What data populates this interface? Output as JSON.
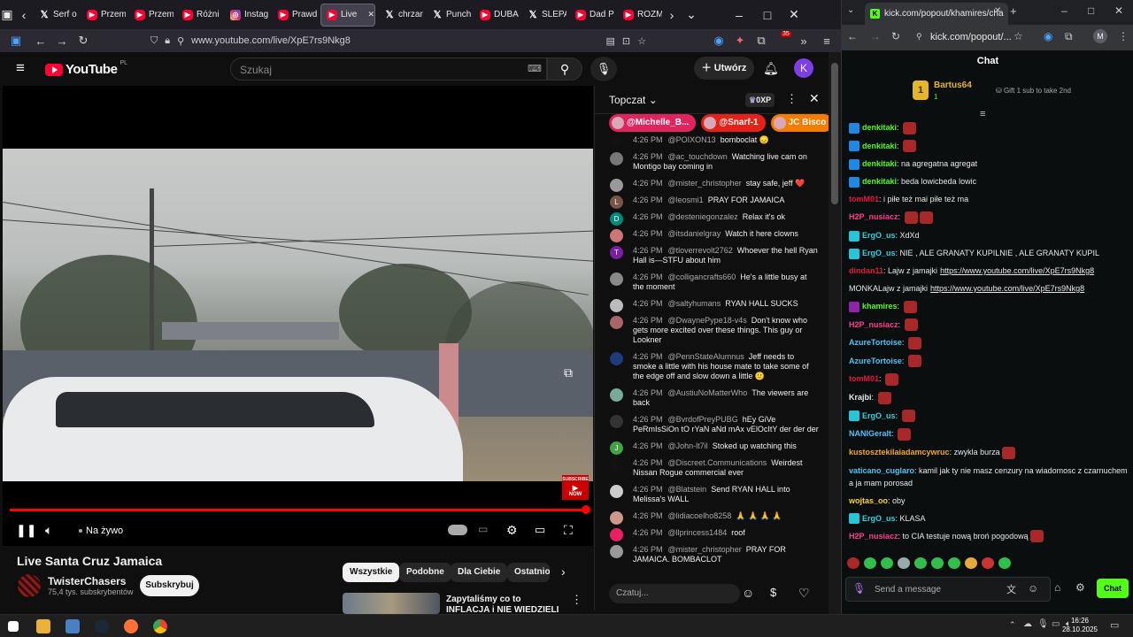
{
  "left_browser": {
    "tabs": [
      {
        "label": "Serf o",
        "icon": "x-icon"
      },
      {
        "label": "Przem",
        "icon": "youtube-icon"
      },
      {
        "label": "Przem",
        "icon": "youtube-icon"
      },
      {
        "label": "Różni",
        "icon": "youtube-icon"
      },
      {
        "label": "Instag",
        "icon": "instagram-icon"
      },
      {
        "label": "Prawd",
        "icon": "youtube-icon"
      },
      {
        "label": "Live",
        "icon": "youtube-icon"
      },
      {
        "label": "chrzan",
        "icon": "x-icon"
      },
      {
        "label": "Punch",
        "icon": "x-icon"
      },
      {
        "label": "DUBA",
        "icon": "youtube-icon"
      },
      {
        "label": "ŚLEPA",
        "icon": "x-icon"
      },
      {
        "label": "Dad P",
        "icon": "youtube-icon"
      },
      {
        "label": "ROZM",
        "icon": "youtube-icon"
      }
    ],
    "url": "www.youtube.com/live/XpE7rs9Nkg8",
    "ext_badge": "35"
  },
  "youtube": {
    "logo_text": "YouTube",
    "logo_region": "PL",
    "search_placeholder": "Szukaj",
    "create_label": "Utwórz",
    "avatar_letter": "K",
    "video": {
      "live_label": "Na żywo",
      "subscribe_badge_line1": "SUBSCRIBE",
      "subscribe_badge_line2": "NOW",
      "progress": 1.0
    },
    "title": "Live Santa Cruz Jamaica",
    "channel": "TwisterChasers",
    "subscribers": "75,4 tys. subskrybentów",
    "subscribe_label": "Subskrybuj",
    "chips": [
      "Wszystkie",
      "Podobne",
      "Dla Ciebie",
      "Ostatnio"
    ],
    "rec_title": "Zapytaliśmy co to INFLACJA i NIE WIEDZIELI"
  },
  "live_chat": {
    "header": "Topczat",
    "xp_badge": "0XP",
    "pinned": [
      {
        "name": "@Michelle_B...",
        "color": "#e0245e"
      },
      {
        "name": "@Snarf-1",
        "color": "#e62117"
      },
      {
        "name": "JC Bisco",
        "color": "#f57c00"
      }
    ],
    "messages": [
      {
        "time": "4:26 PM",
        "author": "@POIXON13",
        "text": "bomboclat 😞",
        "avatar": "",
        "color": "#111"
      },
      {
        "time": "4:26 PM",
        "author": "@ac_touchdown",
        "text": "Watching live cam on Montigo bay coming in",
        "avatar": "",
        "color": "#777"
      },
      {
        "time": "4:26 PM",
        "author": "@mister_christopher",
        "text": "stay safe, jeff ❤️",
        "avatar": "",
        "color": "#999"
      },
      {
        "time": "4:26 PM",
        "author": "@leosmi1",
        "text": "PRAY FOR JAMAICA",
        "avatar": "L",
        "color": "#795548"
      },
      {
        "time": "4:26 PM",
        "author": "@desteniegonzalez",
        "text": "Relax it's ok",
        "avatar": "D",
        "color": "#00897b"
      },
      {
        "time": "4:26 PM",
        "author": "@itsdanielgray",
        "text": "Watch it here clowns",
        "avatar": "",
        "color": "#c77"
      },
      {
        "time": "4:26 PM",
        "author": "@tloverrevolt2762",
        "text": "Whoever the hell Ryan Hall is—STFU about him",
        "avatar": "T",
        "color": "#7b1fa2"
      },
      {
        "time": "4:26 PM",
        "author": "@colligancrafts660",
        "text": "He's a little busy at the moment",
        "avatar": "",
        "color": "#888"
      },
      {
        "time": "4:26 PM",
        "author": "@saltyhumans",
        "text": "RYAN HALL SUCKS",
        "avatar": "",
        "color": "#bbb"
      },
      {
        "time": "4:26 PM",
        "author": "@DwaynePype18-v4s",
        "text": "Don't know who gets more excited over these things. This guy or Lookner",
        "avatar": "",
        "color": "#a66"
      },
      {
        "time": "4:26 PM",
        "author": "@PennStateAlumnus",
        "text": "Jeff needs to smoke a little with his house mate to take some of the edge off and slow down a little 🙂",
        "avatar": "",
        "color": "#1e3a7a"
      },
      {
        "time": "4:26 PM",
        "author": "@AustiuNoMatterWho",
        "text": "The viewers are back",
        "avatar": "",
        "color": "#7a9"
      },
      {
        "time": "4:26 PM",
        "author": "@BvrdofPreyPUBG",
        "text": "hEy GiVe PeRmIsSiOn tO rYaN aNd mAx vElOcItY der der der",
        "avatar": "",
        "color": "#333"
      },
      {
        "time": "4:26 PM",
        "author": "@John-lt7il",
        "text": "Stoked up watching this",
        "avatar": "J",
        "color": "#43a047"
      },
      {
        "time": "4:26 PM",
        "author": "@Discreet.Communications",
        "text": "Weirdest Nissan Rogue commercial ever",
        "avatar": "",
        "color": "#111"
      },
      {
        "time": "4:26 PM",
        "author": "@Blatstein",
        "text": "Send RYAN HALL into Melissa's WALL",
        "avatar": "",
        "color": "#ccc"
      },
      {
        "time": "4:26 PM",
        "author": "@lidiacoelho8258",
        "text": "🙏 🙏 🙏 🙏",
        "avatar": "",
        "color": "#c98"
      },
      {
        "time": "4:26 PM",
        "author": "@llprincess1484",
        "text": "roof",
        "avatar": "",
        "color": "#e91e63"
      },
      {
        "time": "4:26 PM",
        "author": "@mister_christopher",
        "text": "PRAY FOR JAMAICA. BOMBACLOT",
        "avatar": "",
        "color": "#999"
      }
    ],
    "input_placeholder": "Czatuj..."
  },
  "right_browser": {
    "tab_title": "kick.com/popout/khamires/cha",
    "url": "kick.com/popout/...",
    "profile_letter": "M"
  },
  "kick": {
    "title": "Chat",
    "gift_rank": "1",
    "gift_user": "Bartus64",
    "gift_count": "1",
    "gift_text": "Gift 1 sub to take 2nd",
    "messages": [
      {
        "user": "denkitaki",
        "color": "#53fc18",
        "text": "",
        "emotes": 1,
        "badge": "#1e88e5"
      },
      {
        "user": "denkitaki",
        "color": "#53fc18",
        "text": "",
        "emotes": 1,
        "badge": "#1e88e5"
      },
      {
        "user": "denkitaki",
        "color": "#53fc18",
        "text": "na agregatna agregat",
        "emotes": 0,
        "badge": "#1e88e5"
      },
      {
        "user": "denkitaki",
        "color": "#53fc18",
        "text": "beda lowicbeda lowic",
        "emotes": 0,
        "badge": "#1e88e5"
      },
      {
        "user": "tomM01",
        "color": "#e5193c",
        "text": "i piłe też mai piłe też ma",
        "emotes": 0,
        "badge": ""
      },
      {
        "user": "H2P_nusiacz",
        "color": "#ff3b8e",
        "text": "",
        "emotes": 2,
        "badge": ""
      },
      {
        "user": "ErgO_us",
        "color": "#35d0e0",
        "text": "XdXd",
        "emotes": 0,
        "badge": "#26c6da"
      },
      {
        "user": "ErgO_us",
        "color": "#35d0e0",
        "text": "NIE , ALE GRANATY KUPILNIE , ALE GRANATY KUPIL",
        "emotes": 0,
        "badge": "#26c6da"
      },
      {
        "user": "dindan11",
        "color": "#e5193c",
        "text": "Lajw z jamajki",
        "link": "https://www.youtube.com/live/XpE7rs9Nkg8",
        "emotes": 0,
        "badge": ""
      },
      {
        "user": "",
        "color": "#e8e8e8",
        "text": "MONKALajw z jamajki",
        "link": "https://www.youtube.com/live/XpE7rs9Nkg8",
        "emotes": 0,
        "badge": ""
      },
      {
        "user": "khamires",
        "color": "#53fc18",
        "text": "",
        "emotes": 1,
        "badge": "#8e24aa"
      },
      {
        "user": "H2P_nusiacz",
        "color": "#ff3b8e",
        "text": "",
        "emotes": 1,
        "badge": ""
      },
      {
        "user": "AzureTortoise",
        "color": "#4fc3f7",
        "text": "",
        "emotes": 1,
        "badge": ""
      },
      {
        "user": "AzureTortoise",
        "color": "#4fc3f7",
        "text": "",
        "emotes": 1,
        "badge": ""
      },
      {
        "user": "tomM01",
        "color": "#e5193c",
        "text": "",
        "emotes": 1,
        "badge": ""
      },
      {
        "user": "Krajbi",
        "color": "#e8e8e8",
        "text": "",
        "emotes": 1,
        "badge": ""
      },
      {
        "user": "ErgO_us",
        "color": "#35d0e0",
        "text": "",
        "emotes": 1,
        "badge": "#26c6da"
      },
      {
        "user": "NANIGeralt",
        "color": "#4fc3f7",
        "text": "",
        "emotes": 1,
        "badge": ""
      },
      {
        "user": "kustosztekilaiadamcywruc",
        "color": "#f5a623",
        "text": "zwykla burza",
        "emotes": 1,
        "badge": ""
      },
      {
        "user": "vaticano_cuglaro",
        "color": "#4fc3f7",
        "text": "kamil jak ty nie masz cenzury na wiadomosc z czarnuchem a ja mam porosad",
        "emotes": 0,
        "badge": ""
      },
      {
        "user": "wojtas_oo",
        "color": "#f5d623",
        "text": "oby",
        "emotes": 0,
        "badge": ""
      },
      {
        "user": "ErgO_us",
        "color": "#35d0e0",
        "text": "KLASA",
        "emotes": 0,
        "badge": "#26c6da"
      },
      {
        "user": "H2P_nusiacz",
        "color": "#ff3b8e",
        "text": "to CIA testuje nową broń pogodową",
        "emotes": 1,
        "badge": ""
      }
    ],
    "input_placeholder": "Send a message",
    "chat_button": "Chat"
  },
  "taskbar": {
    "time": "16:26",
    "date": "28.10.2025"
  }
}
